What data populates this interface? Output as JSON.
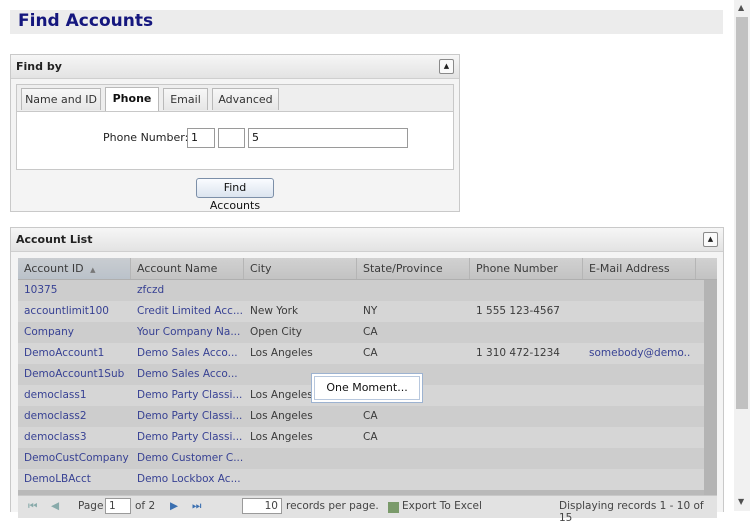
{
  "page": {
    "title": "Find Accounts"
  },
  "find_by": {
    "title": "Find by",
    "collapse_glyph": "▲",
    "tabs": [
      "Name and ID",
      "Phone",
      "Email",
      "Advanced"
    ],
    "active_tab": "Phone",
    "phone_label": "Phone Number:",
    "phone_country": "1",
    "phone_area": "",
    "phone_number": "5",
    "find_button": "Find Accounts"
  },
  "account_list": {
    "title": "Account List",
    "collapse_glyph": "▲",
    "columns": [
      "Account ID",
      "Account Name",
      "City",
      "State/Province",
      "Phone Number",
      "E-Mail Address"
    ],
    "sort_indicator": "▲",
    "rows": [
      [
        "10375",
        "zfczd",
        "",
        "",
        "",
        ""
      ],
      [
        "accountlimit100",
        "Credit Limited Acc...",
        "New York",
        "NY",
        "1 555 123-4567",
        ""
      ],
      [
        "Company",
        "Your Company Na...",
        "Open City",
        "CA",
        "",
        ""
      ],
      [
        "DemoAccount1",
        "Demo Sales Acco...",
        "Los Angeles",
        "CA",
        "1 310 472-1234",
        "somebody@demo..."
      ],
      [
        "DemoAccount1Sub",
        "Demo Sales Acco...",
        "",
        "",
        "",
        ""
      ],
      [
        "democlass1",
        "Demo Party Classi...",
        "Los Angeles",
        "",
        "",
        ""
      ],
      [
        "democlass2",
        "Demo Party Classi...",
        "Los Angeles",
        "CA",
        "",
        ""
      ],
      [
        "democlass3",
        "Demo Party Classi...",
        "Los Angeles",
        "CA",
        "",
        ""
      ],
      [
        "DemoCustCompany",
        "Demo Customer C...",
        "",
        "",
        "",
        ""
      ],
      [
        "DemoLBAcct",
        "Demo Lockbox Ac...",
        "",
        "",
        "",
        ""
      ]
    ],
    "pager": {
      "first_icon": "⏮",
      "prev_icon": "◀",
      "page_label": "Page",
      "page_value": "1",
      "of_label": "of 2",
      "next_icon": "▶",
      "last_icon": "⏭",
      "per_page_value": "10",
      "per_page_label": "records per page.",
      "export_label": "Export To Excel",
      "display_label": "Displaying records 1 - 10 of 15"
    }
  },
  "loading": {
    "text": "One Moment..."
  }
}
